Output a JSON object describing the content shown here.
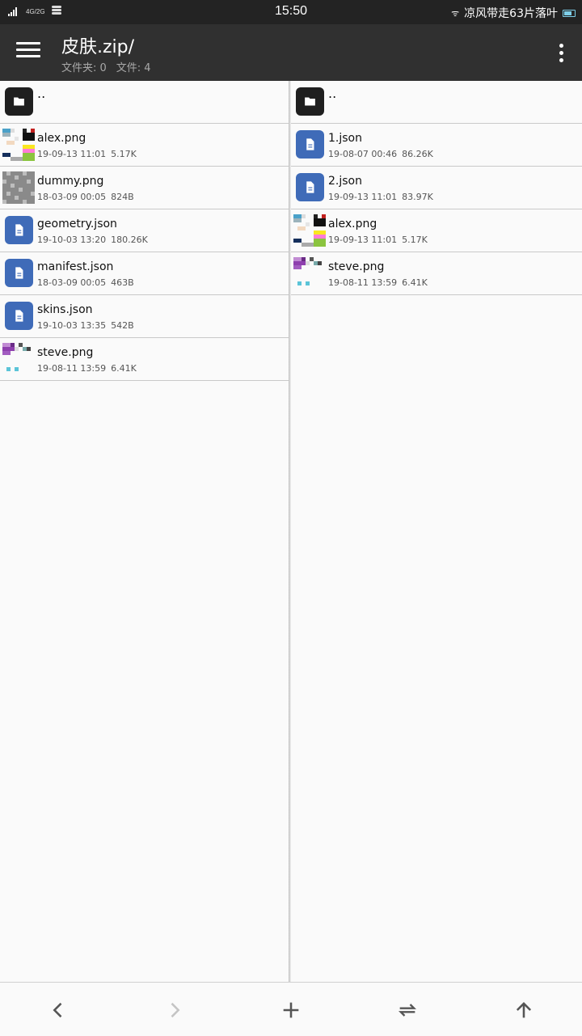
{
  "status_bar": {
    "carrier_tiny": "4G/2G",
    "time": "15:50",
    "notification": "凉风带走63片落叶"
  },
  "toolbar": {
    "title": "皮肤.zip/",
    "folders_label": "文件夹: 0",
    "files_label": "文件: 4",
    "menu_icon": "hamburger-menu-icon",
    "more_icon": "more-vert-icon"
  },
  "left_pane": {
    "up_dir": "..",
    "files": [
      {
        "name": "alex.png",
        "date": "19-09-13 11:01",
        "size": "5.17K",
        "icon": "image-thumb-alex"
      },
      {
        "name": "dummy.png",
        "date": "18-03-09 00:05",
        "size": "824B",
        "icon": "image-thumb-dummy"
      },
      {
        "name": "geometry.json",
        "date": "19-10-03 13:20",
        "size": "180.26K",
        "icon": "document-icon"
      },
      {
        "name": "manifest.json",
        "date": "18-03-09 00:05",
        "size": "463B",
        "icon": "document-icon"
      },
      {
        "name": "skins.json",
        "date": "19-10-03 13:35",
        "size": "542B",
        "icon": "document-icon"
      },
      {
        "name": "steve.png",
        "date": "19-08-11 13:59",
        "size": "6.41K",
        "icon": "image-thumb-steve"
      }
    ]
  },
  "right_pane": {
    "up_dir": "..",
    "files": [
      {
        "name": "1.json",
        "date": "19-08-07 00:46",
        "size": "86.26K",
        "icon": "document-icon"
      },
      {
        "name": "2.json",
        "date": "19-09-13 11:01",
        "size": "83.97K",
        "icon": "document-icon"
      },
      {
        "name": "alex.png",
        "date": "19-09-13 11:01",
        "size": "5.17K",
        "icon": "image-thumb-alex"
      },
      {
        "name": "steve.png",
        "date": "19-08-11 13:59",
        "size": "6.41K",
        "icon": "image-thumb-steve"
      }
    ]
  },
  "bottom_bar": {
    "back_icon": "chevron-left-icon",
    "forward_icon": "chevron-right-icon",
    "add_icon": "plus-icon",
    "swap_icon": "swap-icon",
    "up_icon": "arrow-up-icon"
  },
  "colors": {
    "toolbar_bg": "#303030",
    "status_bg": "#232323",
    "doc_icon_bg": "#3f6bb8",
    "folder_icon_bg": "#1f1f1f"
  }
}
